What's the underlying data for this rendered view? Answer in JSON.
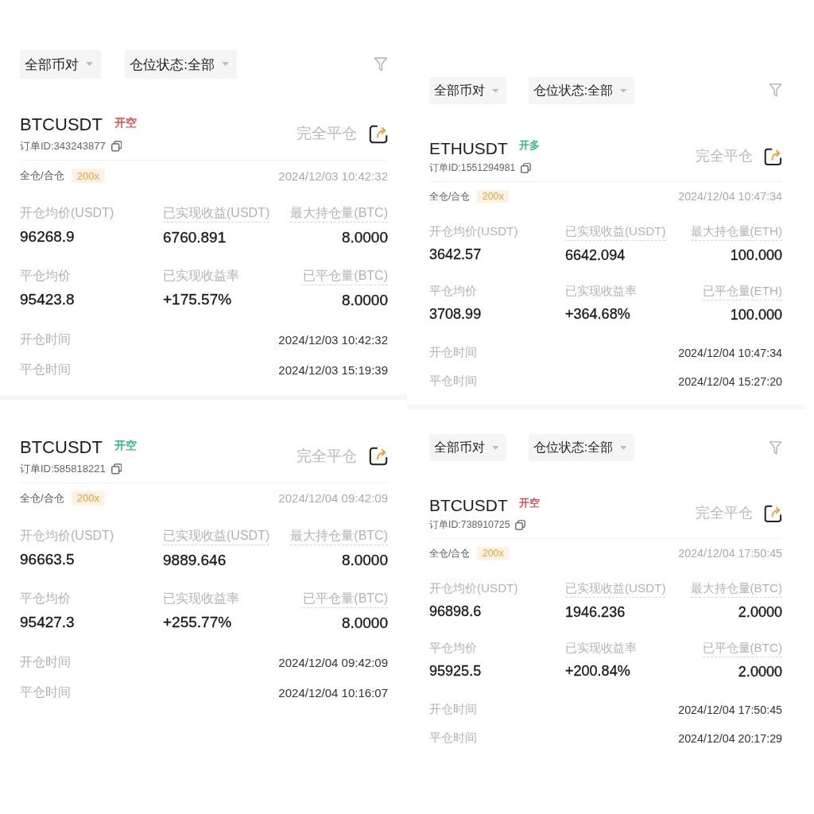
{
  "columns": [
    {
      "panels": [
        {
          "filters": {
            "pair": "全部币对",
            "status": "仓位状态:全部"
          },
          "order": {
            "symbol": "BTCUSDT",
            "side": {
              "label": "开空",
              "color": "#d64b4b"
            },
            "order_id": "订单ID:343243877",
            "close_action": "完全平仓",
            "margin_mode": "全仓/合仓",
            "leverage": "200x",
            "created_at": "2024/12/03 10:42:32",
            "stats": [
              {
                "label": "开仓均价(USDT)",
                "value": "96268.9",
                "tooltip": false
              },
              {
                "label": "已实现收益(USDT)",
                "value": "6760.891",
                "tooltip": true
              },
              {
                "label": "最大持仓量(BTC)",
                "value": "8.0000",
                "tooltip": true
              },
              {
                "label": "平仓均价",
                "value": "95423.8",
                "tooltip": false
              },
              {
                "label": "已实现收益率",
                "value": "+175.57%",
                "tooltip": false
              },
              {
                "label": "已平仓量(BTC)",
                "value": "8.0000",
                "tooltip": true
              }
            ],
            "times": [
              {
                "label": "开仓时间",
                "value": "2024/12/03 10:42:32"
              },
              {
                "label": "平仓时间",
                "value": "2024/12/03 15:19:39"
              }
            ]
          }
        },
        {
          "order": {
            "symbol": "BTCUSDT",
            "side": {
              "label": "开空",
              "color": "#2bb583"
            },
            "order_id": "订单ID:585818221",
            "close_action": "完全平仓",
            "margin_mode": "全仓/合仓",
            "leverage": "200x",
            "created_at": "2024/12/04 09:42:09",
            "stats": [
              {
                "label": "开仓均价(USDT)",
                "value": "96663.5",
                "tooltip": false
              },
              {
                "label": "已实现收益(USDT)",
                "value": "9889.646",
                "tooltip": true
              },
              {
                "label": "最大持仓量(BTC)",
                "value": "8.0000",
                "tooltip": true
              },
              {
                "label": "平仓均价",
                "value": "95427.3",
                "tooltip": false
              },
              {
                "label": "已实现收益率",
                "value": "+255.77%",
                "tooltip": false
              },
              {
                "label": "已平仓量(BTC)",
                "value": "8.0000",
                "tooltip": true
              }
            ],
            "times": [
              {
                "label": "开仓时间",
                "value": "2024/12/04 09:42:09"
              },
              {
                "label": "平仓时间",
                "value": "2024/12/04 10:16:07"
              }
            ]
          }
        }
      ]
    },
    {
      "panels": [
        {
          "filters": {
            "pair": "全部币对",
            "status": "仓位状态:全部"
          },
          "order": {
            "symbol": "ETHUSDT",
            "side": {
              "label": "开多",
              "color": "#2bb583"
            },
            "order_id": "订单ID:1551294981",
            "close_action": "完全平仓",
            "margin_mode": "全仓/合仓",
            "leverage": "200x",
            "created_at": "2024/12/04 10:47:34",
            "stats": [
              {
                "label": "开仓均价(USDT)",
                "value": "3642.57",
                "tooltip": false
              },
              {
                "label": "已实现收益(USDT)",
                "value": "6642.094",
                "tooltip": true
              },
              {
                "label": "最大持仓量(ETH)",
                "value": "100.000",
                "tooltip": true
              },
              {
                "label": "平仓均价",
                "value": "3708.99",
                "tooltip": false
              },
              {
                "label": "已实现收益率",
                "value": "+364.68%",
                "tooltip": false
              },
              {
                "label": "已平仓量(ETH)",
                "value": "100.000",
                "tooltip": true
              }
            ],
            "times": [
              {
                "label": "开仓时间",
                "value": "2024/12/04 10:47:34"
              },
              {
                "label": "平仓时间",
                "value": "2024/12/04 15:27:20"
              }
            ]
          }
        },
        {
          "filters": {
            "pair": "全部币对",
            "status": "仓位状态:全部"
          },
          "order": {
            "symbol": "BTCUSDT",
            "side": {
              "label": "开空",
              "color": "#d64b4b"
            },
            "order_id": "订单ID:738910725",
            "close_action": "完全平仓",
            "margin_mode": "全仓/合仓",
            "leverage": "200x",
            "created_at": "2024/12/04 17:50:45",
            "stats": [
              {
                "label": "开仓均价(USDT)",
                "value": "96898.6",
                "tooltip": false
              },
              {
                "label": "已实现收益(USDT)",
                "value": "1946.236",
                "tooltip": true
              },
              {
                "label": "最大持仓量(BTC)",
                "value": "2.0000",
                "tooltip": true
              },
              {
                "label": "平仓均价",
                "value": "95925.5",
                "tooltip": false
              },
              {
                "label": "已实现收益率",
                "value": "+200.84%",
                "tooltip": false
              },
              {
                "label": "已平仓量(BTC)",
                "value": "2.0000",
                "tooltip": true
              }
            ],
            "times": [
              {
                "label": "开仓时间",
                "value": "2024/12/04 17:50:45"
              },
              {
                "label": "平仓时间",
                "value": "2024/12/04 20:17:29"
              }
            ]
          }
        }
      ]
    }
  ]
}
